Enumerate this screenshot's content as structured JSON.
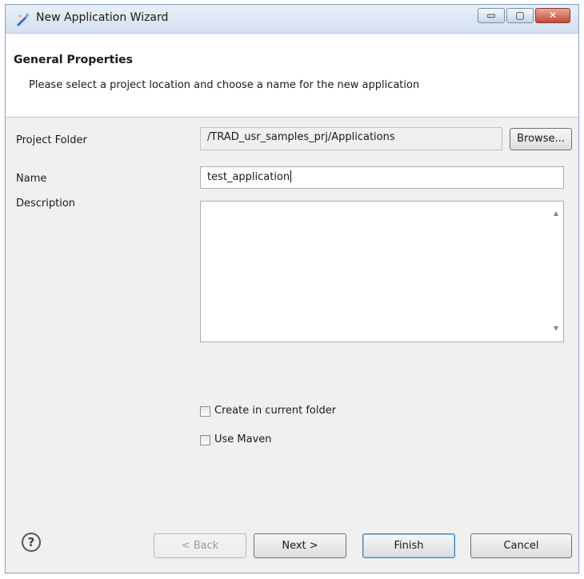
{
  "window": {
    "title": "New Application Wizard",
    "minimize_glyph": "▭",
    "maximize_glyph": "▢",
    "close_glyph": "✕"
  },
  "header": {
    "title": "General Properties",
    "description": "Please select a project location and choose a name for the new application"
  },
  "form": {
    "project_folder_label": "Project Folder",
    "project_folder_value": "/TRAD_usr_samples_prj/Applications",
    "browse_label": "Browse...",
    "name_label": "Name",
    "name_value": "test_application",
    "description_label": "Description",
    "description_value": "",
    "scroll_up_glyph": "▲",
    "scroll_down_glyph": "▼",
    "create_in_current_folder_label": "Create in current folder",
    "create_in_current_folder_checked": false,
    "use_maven_label": "Use Maven",
    "use_maven_checked": false
  },
  "footer": {
    "help_glyph": "?",
    "back_label": "< Back",
    "next_label": "Next >",
    "finish_label": "Finish",
    "cancel_label": "Cancel"
  },
  "colors": {
    "titlebar": "#dbe6f4",
    "dialog_background": "#f0f0f0",
    "default_button_border": "#3c7fb1",
    "close_button": "#c34a33"
  },
  "icons": {
    "app_icon": "wizard-wand-icon",
    "help": "help-icon"
  }
}
